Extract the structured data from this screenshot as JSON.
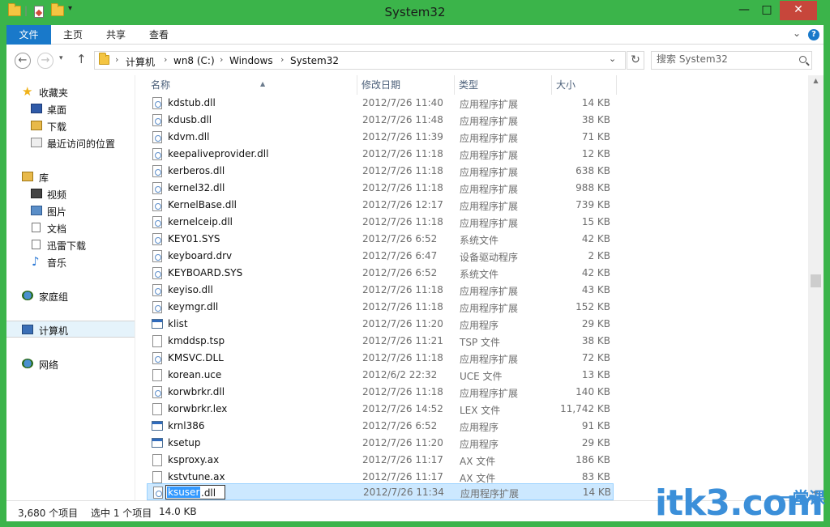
{
  "window": {
    "title": "System32"
  },
  "ribbon": {
    "tabs": [
      "文件",
      "主页",
      "共享",
      "查看"
    ]
  },
  "address": {
    "crumbs": [
      "计算机",
      "wn8 (C:)",
      "Windows",
      "System32"
    ],
    "search_placeholder": "搜索 System32"
  },
  "sidebar": {
    "favorites": {
      "label": "收藏夹",
      "items": [
        "桌面",
        "下载",
        "最近访问的位置"
      ]
    },
    "libraries": {
      "label": "库",
      "items": [
        "视频",
        "图片",
        "文档",
        "迅雷下载",
        "音乐"
      ]
    },
    "homegroup": "家庭组",
    "computer": "计算机",
    "network": "网络"
  },
  "columns": {
    "name": "名称",
    "date": "修改日期",
    "type": "类型",
    "size": "大小"
  },
  "files": [
    {
      "name": "kdstub.dll",
      "date": "2012/7/26 11:40",
      "type": "应用程序扩展",
      "size": "14 KB",
      "icon": "dll-icon"
    },
    {
      "name": "kdusb.dll",
      "date": "2012/7/26 11:48",
      "type": "应用程序扩展",
      "size": "38 KB",
      "icon": "dll-icon"
    },
    {
      "name": "kdvm.dll",
      "date": "2012/7/26 11:39",
      "type": "应用程序扩展",
      "size": "71 KB",
      "icon": "dll-icon"
    },
    {
      "name": "keepaliveprovider.dll",
      "date": "2012/7/26 11:18",
      "type": "应用程序扩展",
      "size": "12 KB",
      "icon": "dll-icon"
    },
    {
      "name": "kerberos.dll",
      "date": "2012/7/26 11:18",
      "type": "应用程序扩展",
      "size": "638 KB",
      "icon": "dll-icon"
    },
    {
      "name": "kernel32.dll",
      "date": "2012/7/26 11:18",
      "type": "应用程序扩展",
      "size": "988 KB",
      "icon": "dll-icon"
    },
    {
      "name": "KernelBase.dll",
      "date": "2012/7/26 12:17",
      "type": "应用程序扩展",
      "size": "739 KB",
      "icon": "dll-icon"
    },
    {
      "name": "kernelceip.dll",
      "date": "2012/7/26 11:18",
      "type": "应用程序扩展",
      "size": "15 KB",
      "icon": "dll-icon"
    },
    {
      "name": "KEY01.SYS",
      "date": "2012/7/26 6:52",
      "type": "系统文件",
      "size": "42 KB",
      "icon": "dll-icon"
    },
    {
      "name": "keyboard.drv",
      "date": "2012/7/26 6:47",
      "type": "设备驱动程序",
      "size": "2 KB",
      "icon": "dll-icon"
    },
    {
      "name": "KEYBOARD.SYS",
      "date": "2012/7/26 6:52",
      "type": "系统文件",
      "size": "42 KB",
      "icon": "dll-icon"
    },
    {
      "name": "keyiso.dll",
      "date": "2012/7/26 11:18",
      "type": "应用程序扩展",
      "size": "43 KB",
      "icon": "dll-icon"
    },
    {
      "name": "keymgr.dll",
      "date": "2012/7/26 11:18",
      "type": "应用程序扩展",
      "size": "152 KB",
      "icon": "dll-icon"
    },
    {
      "name": "klist",
      "date": "2012/7/26 11:20",
      "type": "应用程序",
      "size": "29 KB",
      "icon": "app-icon"
    },
    {
      "name": "kmddsp.tsp",
      "date": "2012/7/26 11:21",
      "type": "TSP 文件",
      "size": "38 KB",
      "icon": "file-icon"
    },
    {
      "name": "KMSVC.DLL",
      "date": "2012/7/26 11:18",
      "type": "应用程序扩展",
      "size": "72 KB",
      "icon": "dll-icon"
    },
    {
      "name": "korean.uce",
      "date": "2012/6/2 22:32",
      "type": "UCE 文件",
      "size": "13 KB",
      "icon": "file-icon"
    },
    {
      "name": "korwbrkr.dll",
      "date": "2012/7/26 11:18",
      "type": "应用程序扩展",
      "size": "140 KB",
      "icon": "dll-icon"
    },
    {
      "name": "korwbrkr.lex",
      "date": "2012/7/26 14:52",
      "type": "LEX 文件",
      "size": "11,742 KB",
      "icon": "file-icon"
    },
    {
      "name": "krnl386",
      "date": "2012/7/26 6:52",
      "type": "应用程序",
      "size": "91 KB",
      "icon": "app-icon"
    },
    {
      "name": "ksetup",
      "date": "2012/7/26 11:20",
      "type": "应用程序",
      "size": "29 KB",
      "icon": "app-icon"
    },
    {
      "name": "ksproxy.ax",
      "date": "2012/7/26 11:17",
      "type": "AX 文件",
      "size": "186 KB",
      "icon": "file-icon"
    },
    {
      "name": "kstvtune.ax",
      "date": "2012/7/26 11:17",
      "type": "AX 文件",
      "size": "83 KB",
      "icon": "file-icon"
    }
  ],
  "selected_file": {
    "name_selected_part": "ksuser",
    "name_rest": ".dll",
    "date": "2012/7/26 11:34",
    "type": "应用程序扩展",
    "size": "14 KB"
  },
  "status": {
    "count": "3,680 个项目",
    "selection": "选中 1 个项目",
    "size": "14.0 KB"
  },
  "watermark": {
    "text": "itk3.com",
    "sub": "一堂课"
  },
  "colors": {
    "frame": "#3bb44a",
    "file_tab": "#1979ca",
    "selection": "#cce8ff",
    "close": "#c7463b"
  }
}
